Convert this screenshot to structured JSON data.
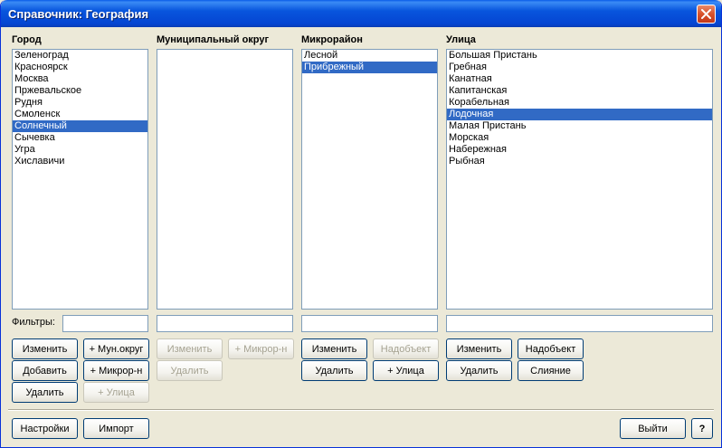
{
  "window": {
    "title": "Справочник: География"
  },
  "columns": {
    "city": {
      "header": "Город",
      "items": [
        "Зеленоград",
        "Красноярск",
        "Москва",
        "Пржевальское",
        "Рудня",
        "Смоленск",
        "Солнечный",
        "Сычевка",
        "Угра",
        "Хиславичи"
      ],
      "selected_index": 6
    },
    "district": {
      "header": "Муниципальный округ",
      "items": []
    },
    "microdistrict": {
      "header": "Микрорайон",
      "items": [
        "Лесной",
        "Прибрежный"
      ],
      "selected_index": 1
    },
    "street": {
      "header": "Улица",
      "items": [
        "Большая Пристань",
        "Гребная",
        "Канатная",
        "Капитанская",
        "Корабельная",
        "Лодочная",
        "Малая Пристань",
        "Морская",
        "Набережная",
        "Рыбная"
      ],
      "selected_index": 5
    }
  },
  "filters": {
    "label": "Фильтры:"
  },
  "buttons": {
    "city_edit": "Изменить",
    "city_add": "Добавить",
    "city_delete": "Удалить",
    "city_add_district": "+ Мун.округ",
    "city_add_micro": "+ Микрор-н",
    "city_add_street": "+ Улица",
    "district_edit": "Изменить",
    "district_delete": "Удалить",
    "district_add_micro": "+ Микрор-н",
    "micro_edit": "Изменить",
    "micro_delete": "Удалить",
    "micro_parent": "Надобъект",
    "micro_add_street": "+ Улица",
    "street_edit": "Изменить",
    "street_delete": "Удалить",
    "street_parent": "Надобъект",
    "street_merge": "Слияние",
    "settings": "Настройки",
    "import": "Импорт",
    "exit": "Выйти",
    "help": "?"
  },
  "icons": {
    "close": "close-icon"
  },
  "colors": {
    "titlebar": "#0855dd",
    "selection": "#316ac5",
    "close": "#d8532c"
  }
}
